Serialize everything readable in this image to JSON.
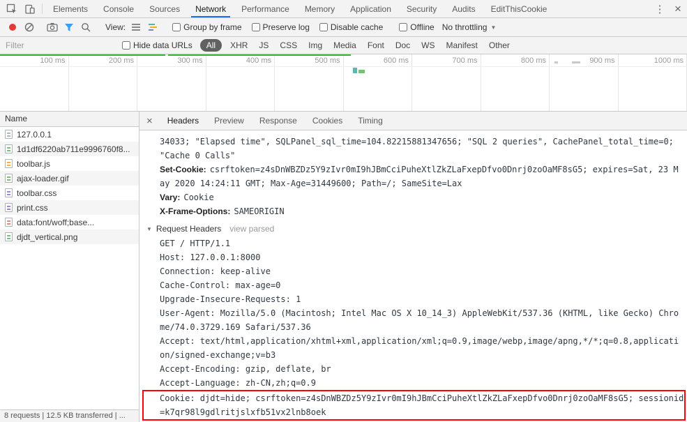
{
  "window": {
    "devtools_tabs": [
      "Elements",
      "Console",
      "Sources",
      "Network",
      "Performance",
      "Memory",
      "Application",
      "Security",
      "Audits",
      "EditThisCookie"
    ],
    "active_tab": "Network"
  },
  "icons": {
    "more_menu": "⋮",
    "close": "×",
    "dropdown_caret": "▼",
    "section_triangle": "▼",
    "details_close": "×"
  },
  "colors": {
    "tab_underline_blue": "#1a73e8",
    "record_red": "#e53935",
    "filter_funnel_blue": "#3b9ef7",
    "timeline_green": "#35b435",
    "highlight_box_red": "#ff0000",
    "active_filter_pill_bg": "#616161"
  },
  "network_toolbar": {
    "view_label": "View:",
    "group_by_frame": "Group by frame",
    "preserve_log": "Preserve log",
    "disable_cache": "Disable cache",
    "offline": "Offline",
    "throttling": "No throttling"
  },
  "filter_bar": {
    "filter_placeholder": "Filter",
    "hide_data_urls": "Hide data URLs",
    "types": [
      "All",
      "XHR",
      "JS",
      "CSS",
      "Img",
      "Media",
      "Font",
      "Doc",
      "WS",
      "Manifest",
      "Other"
    ],
    "active_type": "All"
  },
  "timeline": {
    "ticks": [
      "100 ms",
      "200 ms",
      "300 ms",
      "400 ms",
      "500 ms",
      "600 ms",
      "700 ms",
      "800 ms",
      "900 ms",
      "1000 ms"
    ]
  },
  "requests_panel": {
    "header": "Name",
    "rows": [
      {
        "name": "127.0.0.1",
        "type": "document"
      },
      {
        "name": "1d1df6220ab711e9996760f8...",
        "type": "image"
      },
      {
        "name": "toolbar.js",
        "type": "script"
      },
      {
        "name": "ajax-loader.gif",
        "type": "image"
      },
      {
        "name": "toolbar.css",
        "type": "stylesheet"
      },
      {
        "name": "print.css",
        "type": "stylesheet"
      },
      {
        "name": "data:font/woff;base...",
        "type": "font"
      },
      {
        "name": "djdt_vertical.png",
        "type": "image"
      }
    ],
    "summary": "8 requests | 12.5 KB transferred | ..."
  },
  "details_panel": {
    "tabs": [
      "Headers",
      "Preview",
      "Response",
      "Cookies",
      "Timing"
    ],
    "active_tab": "Headers",
    "response_headers_overflow": [
      "34033; \"Elapsed time\", SQLPanel_sql_time=104.82215881347656; \"SQL 2 queries\", CachePanel_total_time=0; \"Cache 0 Calls\""
    ],
    "response_headers": [
      {
        "name": "Set-Cookie:",
        "value": "csrftoken=z4sDnWBZDz5Y9zIvr0mI9hJBmCciPuheXtlZkZLaFxepDfvo0Dnrj0zoOaMF8sG5; expires=Sat, 23 May 2020 14:24:11 GMT; Max-Age=31449600; Path=/; SameSite=Lax"
      },
      {
        "name": "Vary:",
        "value": "Cookie"
      },
      {
        "name": "X-Frame-Options:",
        "value": "SAMEORIGIN"
      }
    ],
    "request_headers_title": "Request Headers",
    "view_parsed": "view parsed",
    "raw_request_headers": [
      "GET / HTTP/1.1",
      "Host: 127.0.0.1:8000",
      "Connection: keep-alive",
      "Cache-Control: max-age=0",
      "Upgrade-Insecure-Requests: 1",
      "User-Agent: Mozilla/5.0 (Macintosh; Intel Mac OS X 10_14_3) AppleWebKit/537.36 (KHTML, like Gecko) Chrome/74.0.3729.169 Safari/537.36",
      "Accept: text/html,application/xhtml+xml,application/xml;q=0.9,image/webp,image/apng,*/*;q=0.8,application/signed-exchange;v=b3",
      "Accept-Encoding: gzip, deflate, br",
      "Accept-Language: zh-CN,zh;q=0.9"
    ],
    "highlighted_header": "Cookie: djdt=hide; csrftoken=z4sDnWBZDz5Y9zIvr0mI9hJBmCciPuheXtlZkZLaFxepDfvo0Dnrj0zoOaMF8sG5; sessionid=k7qr98l9gdlritjslxfb51vx2lnb8oek"
  }
}
